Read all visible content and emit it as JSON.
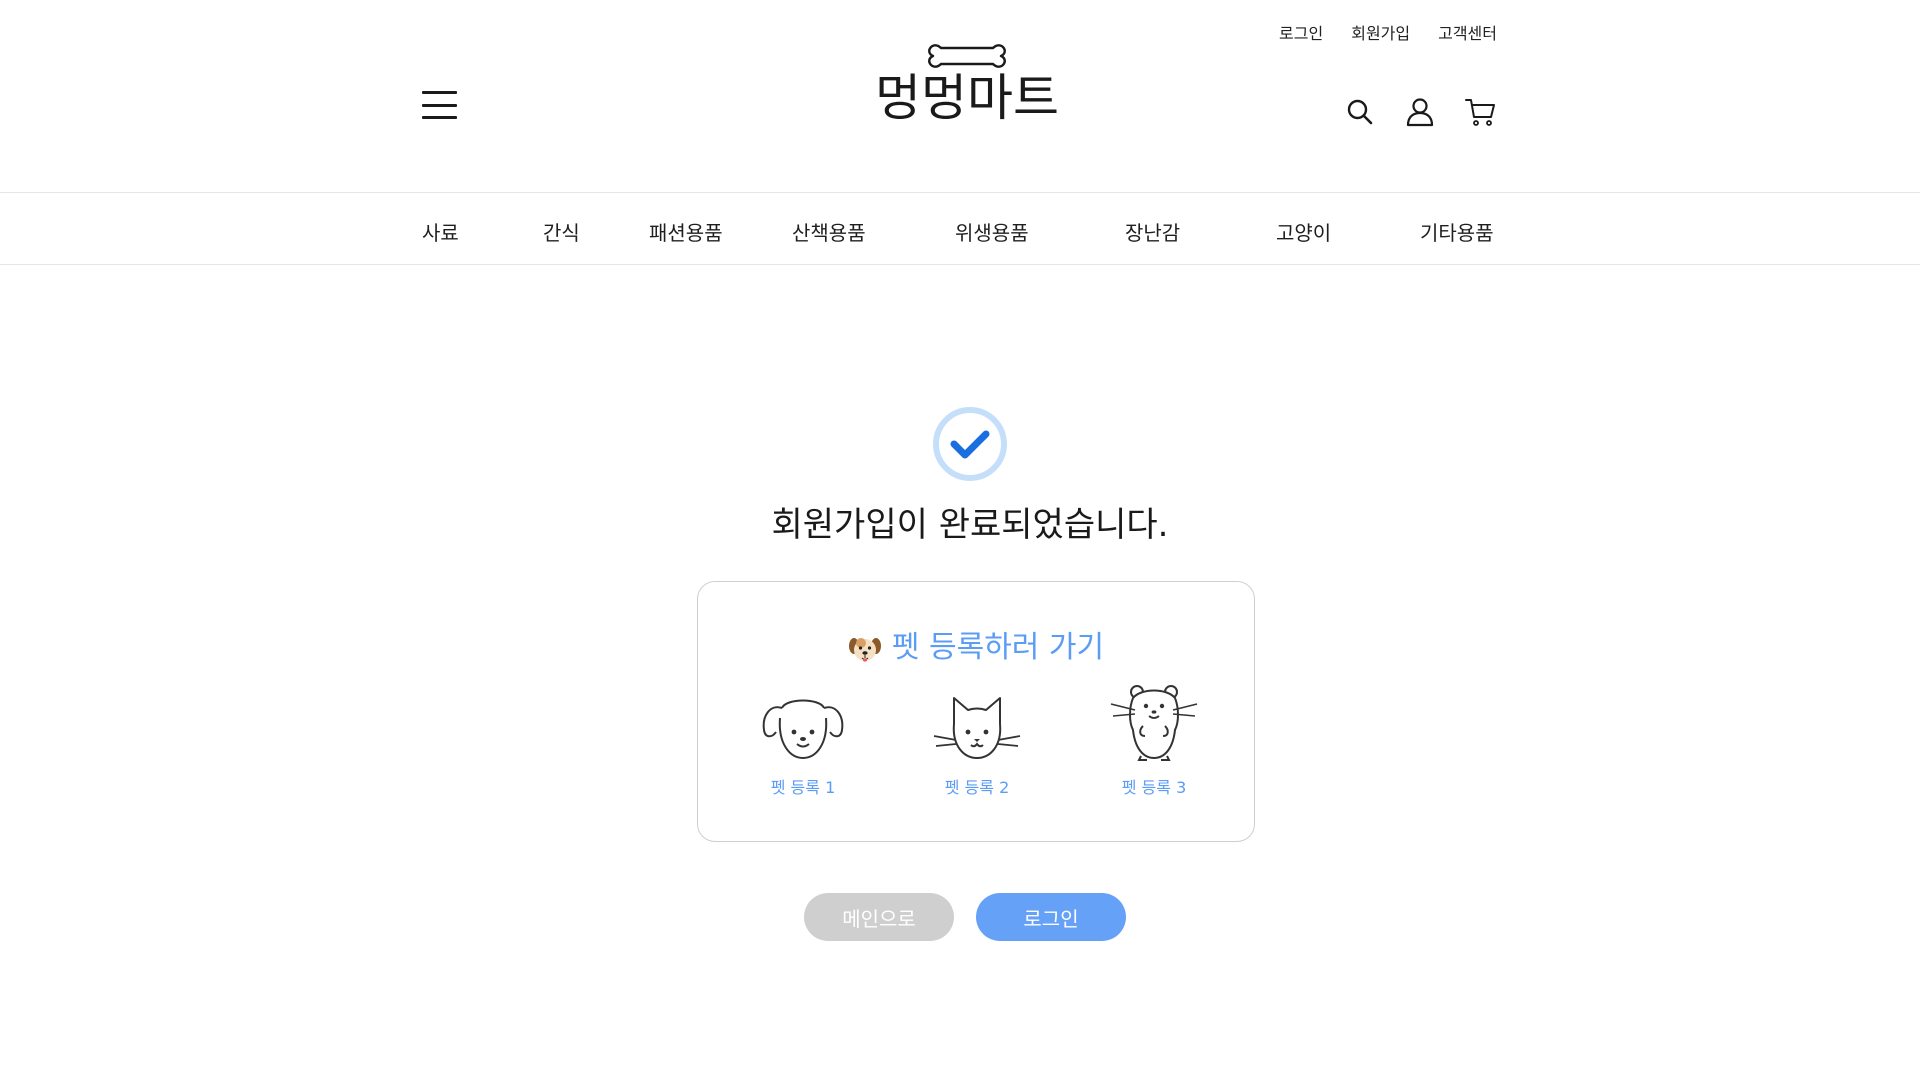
{
  "top_links": [
    "로그인",
    "회원가입",
    "고객센터"
  ],
  "logo": {
    "text": "멍멍마트"
  },
  "header_icons": [
    "search-icon",
    "user-icon",
    "cart-icon"
  ],
  "nav": [
    "사료",
    "간식",
    "패션용품",
    "산책용품",
    "위생용품",
    "장난감",
    "고양이",
    "기타용품"
  ],
  "content": {
    "title": "회원가입이 완료되었습니다.",
    "pet_card_title": "펫 등록하러 가기",
    "pets": [
      {
        "label": "펫 등록 1",
        "icon": "dog-icon"
      },
      {
        "label": "펫 등록 2",
        "icon": "cat-icon"
      },
      {
        "label": "펫 등록 3",
        "icon": "hamster-icon"
      }
    ]
  },
  "buttons": {
    "main": "메인으로",
    "login": "로그인"
  },
  "colors": {
    "accent": "#5b9cf5",
    "button_primary": "#66a1f8",
    "button_secondary": "#cfcfcf",
    "check": "#1a6fe0"
  }
}
